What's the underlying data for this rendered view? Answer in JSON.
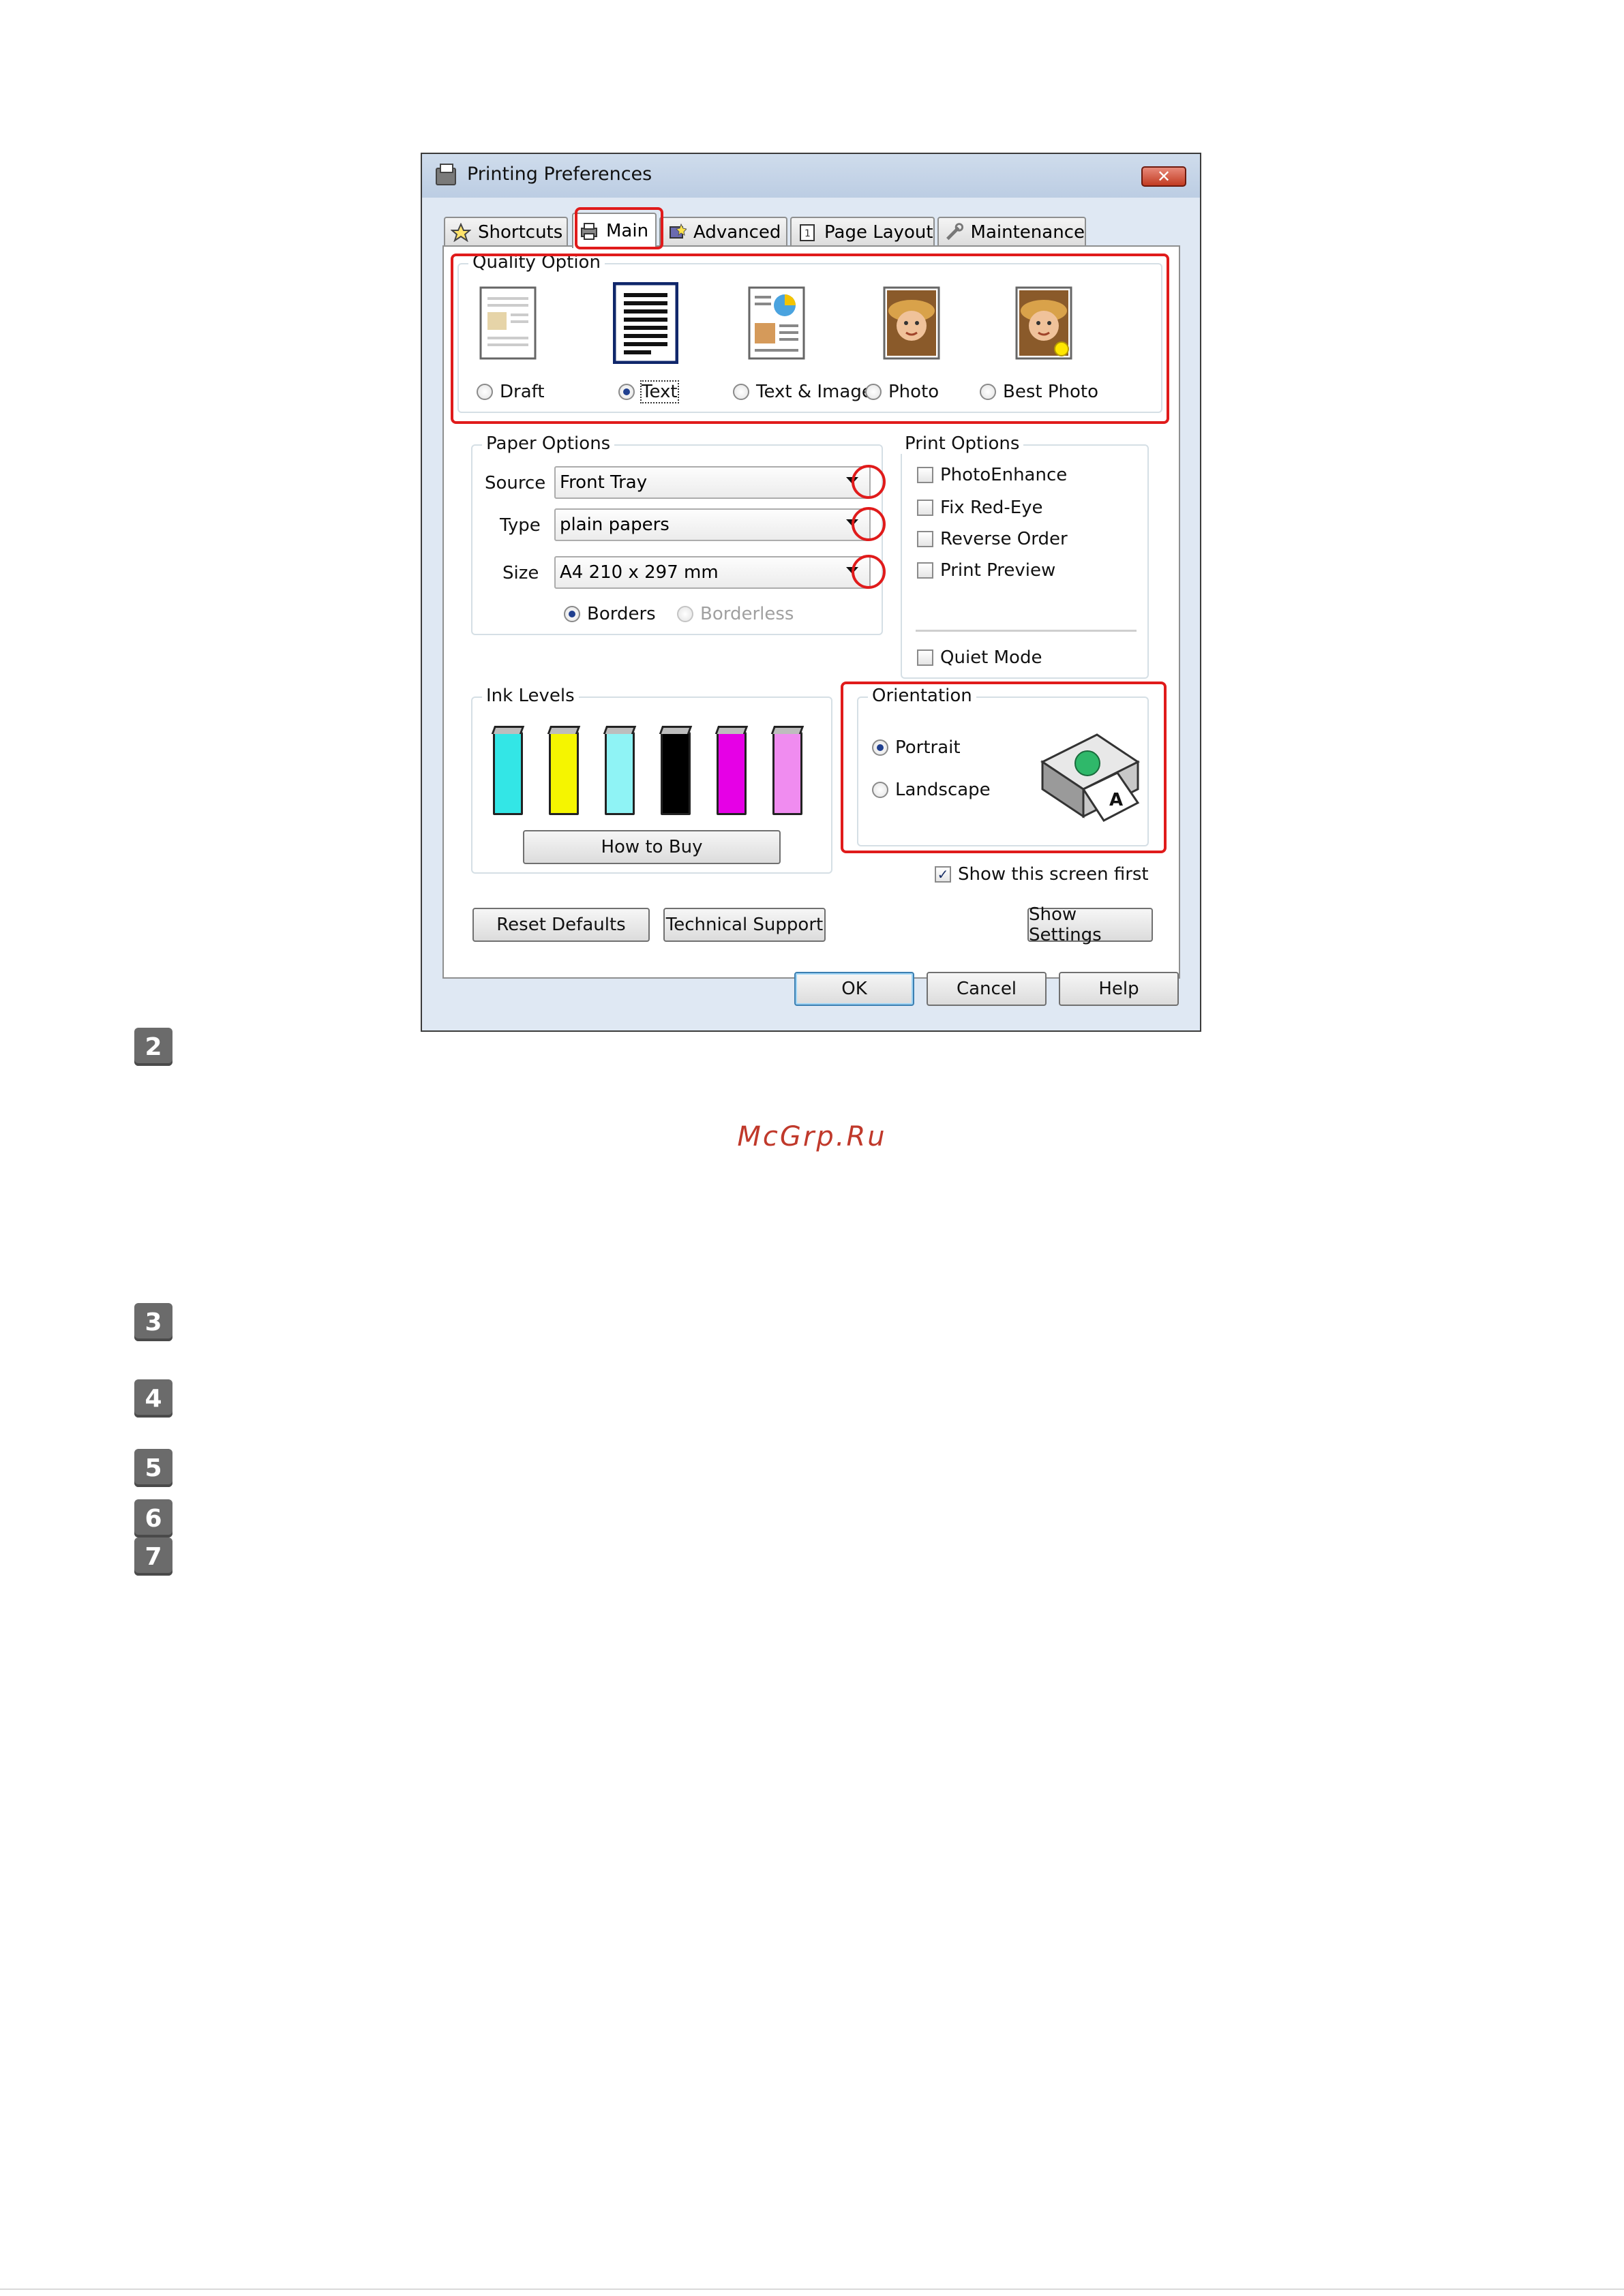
{
  "dialog": {
    "title": "Printing Preferences",
    "close_label": "✕",
    "tabs": [
      {
        "label": "Shortcuts",
        "icon": "star-icon"
      },
      {
        "label": "Main",
        "icon": "printer-icon"
      },
      {
        "label": "Advanced",
        "icon": "wand-icon"
      },
      {
        "label": "Page Layout",
        "icon": "page-icon"
      },
      {
        "label": "Maintenance",
        "icon": "wrench-icon"
      }
    ],
    "active_tab": "Main"
  },
  "quality": {
    "title": "Quality Option",
    "options": [
      {
        "label": "Draft",
        "selected": false
      },
      {
        "label": "Text",
        "selected": true
      },
      {
        "label": "Text & Image",
        "selected": false
      },
      {
        "label": "Photo",
        "selected": false
      },
      {
        "label": "Best Photo",
        "selected": false
      }
    ]
  },
  "paper": {
    "title": "Paper Options",
    "source_label": "Source",
    "source_value": "Front Tray",
    "type_label": "Type",
    "type_value": "plain papers",
    "size_label": "Size",
    "size_value": "A4 210 x 297 mm",
    "borders_label": "Borders",
    "borderless_label": "Borderless"
  },
  "print_options": {
    "title": "Print Options",
    "items": [
      {
        "label": "PhotoEnhance",
        "checked": false
      },
      {
        "label": "Fix Red-Eye",
        "checked": false
      },
      {
        "label": "Reverse Order",
        "checked": false
      },
      {
        "label": "Print Preview",
        "checked": false
      }
    ],
    "quiet_mode": "Quiet Mode"
  },
  "ink": {
    "title": "Ink Levels",
    "colors": [
      "#33e6e6",
      "#f5f500",
      "#8ff3f5",
      "#000000",
      "#e600e6",
      "#f08cf0"
    ],
    "how_to_buy": "How to Buy"
  },
  "orientation": {
    "title": "Orientation",
    "portrait": "Portrait",
    "landscape": "Landscape"
  },
  "show_first": "Show this screen first",
  "buttons": {
    "reset": "Reset Defaults",
    "support": "Technical Support",
    "show_settings": "Show Settings",
    "ok": "OK",
    "cancel": "Cancel",
    "help": "Help"
  },
  "steps": [
    "2",
    "3",
    "4",
    "5",
    "6",
    "7"
  ],
  "watermark": "McGrp.Ru",
  "colors": {
    "highlight": "#e01b1b",
    "titlebar": "#c5d6ea"
  }
}
